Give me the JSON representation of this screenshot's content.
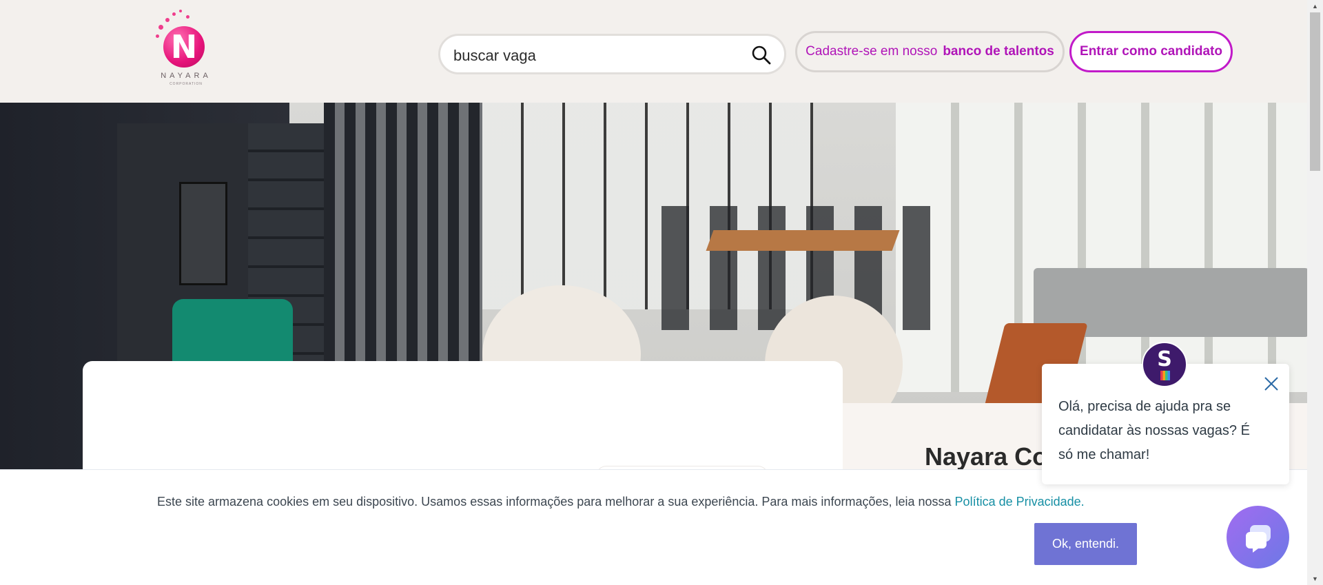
{
  "header": {
    "logo": {
      "name": "NAYARA",
      "sub": "CORPORATION",
      "letter": "N"
    },
    "search": {
      "value": "buscar vaga",
      "icon": "search-icon"
    },
    "talent_button": {
      "prefix": "Cadastre-se em nosso",
      "strong": "banco de talentos"
    },
    "login_button": "Entrar como candidato"
  },
  "main": {
    "company_name": "Nayara Co"
  },
  "cookie_banner": {
    "text": "Este site armazena cookies em seu dispositivo. Usamos essas informações para melhorar a sua experiência. Para mais informações, leia nossa",
    "link": "Política de Privacidade.",
    "button": "Ok, entendi."
  },
  "chat": {
    "avatar_letter": "S",
    "message": "Olá, precisa de ajuda pra se candidatar às nossas vagas? É só me chamar!",
    "close_icon": "close-icon",
    "launcher_icon": "chat-bubble-icon"
  },
  "colors": {
    "brand": "#b014b8",
    "header_bg": "#f3f0ed",
    "cookie_button": "#6f73d4",
    "link": "#168fa4"
  }
}
